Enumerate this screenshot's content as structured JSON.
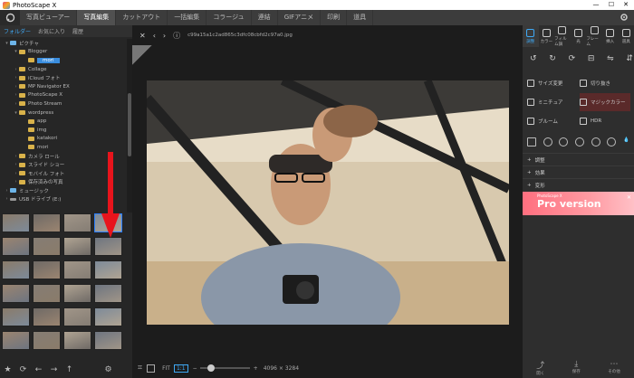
{
  "window": {
    "title": "PhotoScape X",
    "controls": [
      "—",
      "☐",
      "✕"
    ]
  },
  "menu": {
    "tabs": [
      "写真ビューアー",
      "写真編集",
      "カットアウト",
      "一括編集",
      "コラージュ",
      "連結",
      "GIFアニメ",
      "印刷",
      "道具"
    ],
    "active_index": 1
  },
  "left": {
    "tabs": [
      "フォルダー",
      "お気に入り",
      "履歴"
    ],
    "active_tab": 0,
    "tree": [
      {
        "label": "ピクチャ",
        "depth": 0,
        "type": "blue",
        "arrow": "▾"
      },
      {
        "label": "Blogger",
        "depth": 1,
        "type": "folder",
        "arrow": "▾"
      },
      {
        "label": "mori",
        "depth": 2,
        "type": "folder",
        "arrow": "",
        "selected": true
      },
      {
        "label": "Collage",
        "depth": 1,
        "type": "folder",
        "arrow": "›"
      },
      {
        "label": "iCloud フォト",
        "depth": 1,
        "type": "folder",
        "arrow": "›"
      },
      {
        "label": "MP Navigator EX",
        "depth": 1,
        "type": "folder",
        "arrow": "›"
      },
      {
        "label": "PhotoScape X",
        "depth": 1,
        "type": "folder",
        "arrow": "›"
      },
      {
        "label": "Photo Stream",
        "depth": 1,
        "type": "folder",
        "arrow": "›"
      },
      {
        "label": "wordpress",
        "depth": 1,
        "type": "folder",
        "arrow": "▾"
      },
      {
        "label": "app",
        "depth": 2,
        "type": "folder",
        "arrow": ""
      },
      {
        "label": "img",
        "depth": 2,
        "type": "folder",
        "arrow": ""
      },
      {
        "label": "katakori",
        "depth": 2,
        "type": "folder",
        "arrow": ""
      },
      {
        "label": "mori",
        "depth": 2,
        "type": "folder",
        "arrow": ""
      },
      {
        "label": "カメラ ロール",
        "depth": 1,
        "type": "folder",
        "arrow": "›"
      },
      {
        "label": "スライド ショー",
        "depth": 1,
        "type": "folder",
        "arrow": "›"
      },
      {
        "label": "モバイル フォト",
        "depth": 1,
        "type": "folder",
        "arrow": "›"
      },
      {
        "label": "保存済みの写真",
        "depth": 1,
        "type": "folder",
        "arrow": "›"
      },
      {
        "label": "ミュージック",
        "depth": 0,
        "type": "blue",
        "arrow": "›"
      },
      {
        "label": "USB ドライブ (E:)",
        "depth": 0,
        "type": "drive",
        "arrow": "›"
      }
    ],
    "thumbnails_selected_index": 3,
    "toolbar_icons": [
      "star-icon",
      "refresh-icon",
      "back-icon",
      "forward-icon",
      "up-icon",
      "settings-icon"
    ]
  },
  "viewer": {
    "filename": "c99a15a1c2ad865c3dfc08cbfd2c97a0.jpg",
    "zoom_label": "1:1",
    "fit_label": "FIT",
    "zoom_slider": 0.15,
    "image_size": "4096 × 3284"
  },
  "right": {
    "tools": [
      {
        "label": "調整",
        "active": true
      },
      {
        "label": "カラー",
        "active": false
      },
      {
        "label": "フィルム調",
        "active": false
      },
      {
        "label": "光",
        "active": false
      },
      {
        "label": "フレーム",
        "active": false
      },
      {
        "label": "挿入",
        "active": false
      },
      {
        "label": "道具",
        "active": false
      }
    ],
    "actions": [
      "サイズ変更",
      "切り抜き",
      "ミニチュア",
      "マジックカラー",
      "ブルーム",
      "HDR"
    ],
    "sections": [
      "調整",
      "効果",
      "変形"
    ],
    "pro_banner": {
      "small": "PhotoScape X",
      "big": "Pro version"
    },
    "bottom_buttons": [
      "元に戻す",
      "やり直す",
      "元に戻す全て",
      "比較",
      "元のサイズ",
      "開く",
      "保存",
      "その他"
    ],
    "bottom_labels_visible": [
      "開く",
      "保存",
      "その他"
    ],
    "accent_color": "#3fa9f5",
    "banner_color": "#ff6f7f"
  }
}
